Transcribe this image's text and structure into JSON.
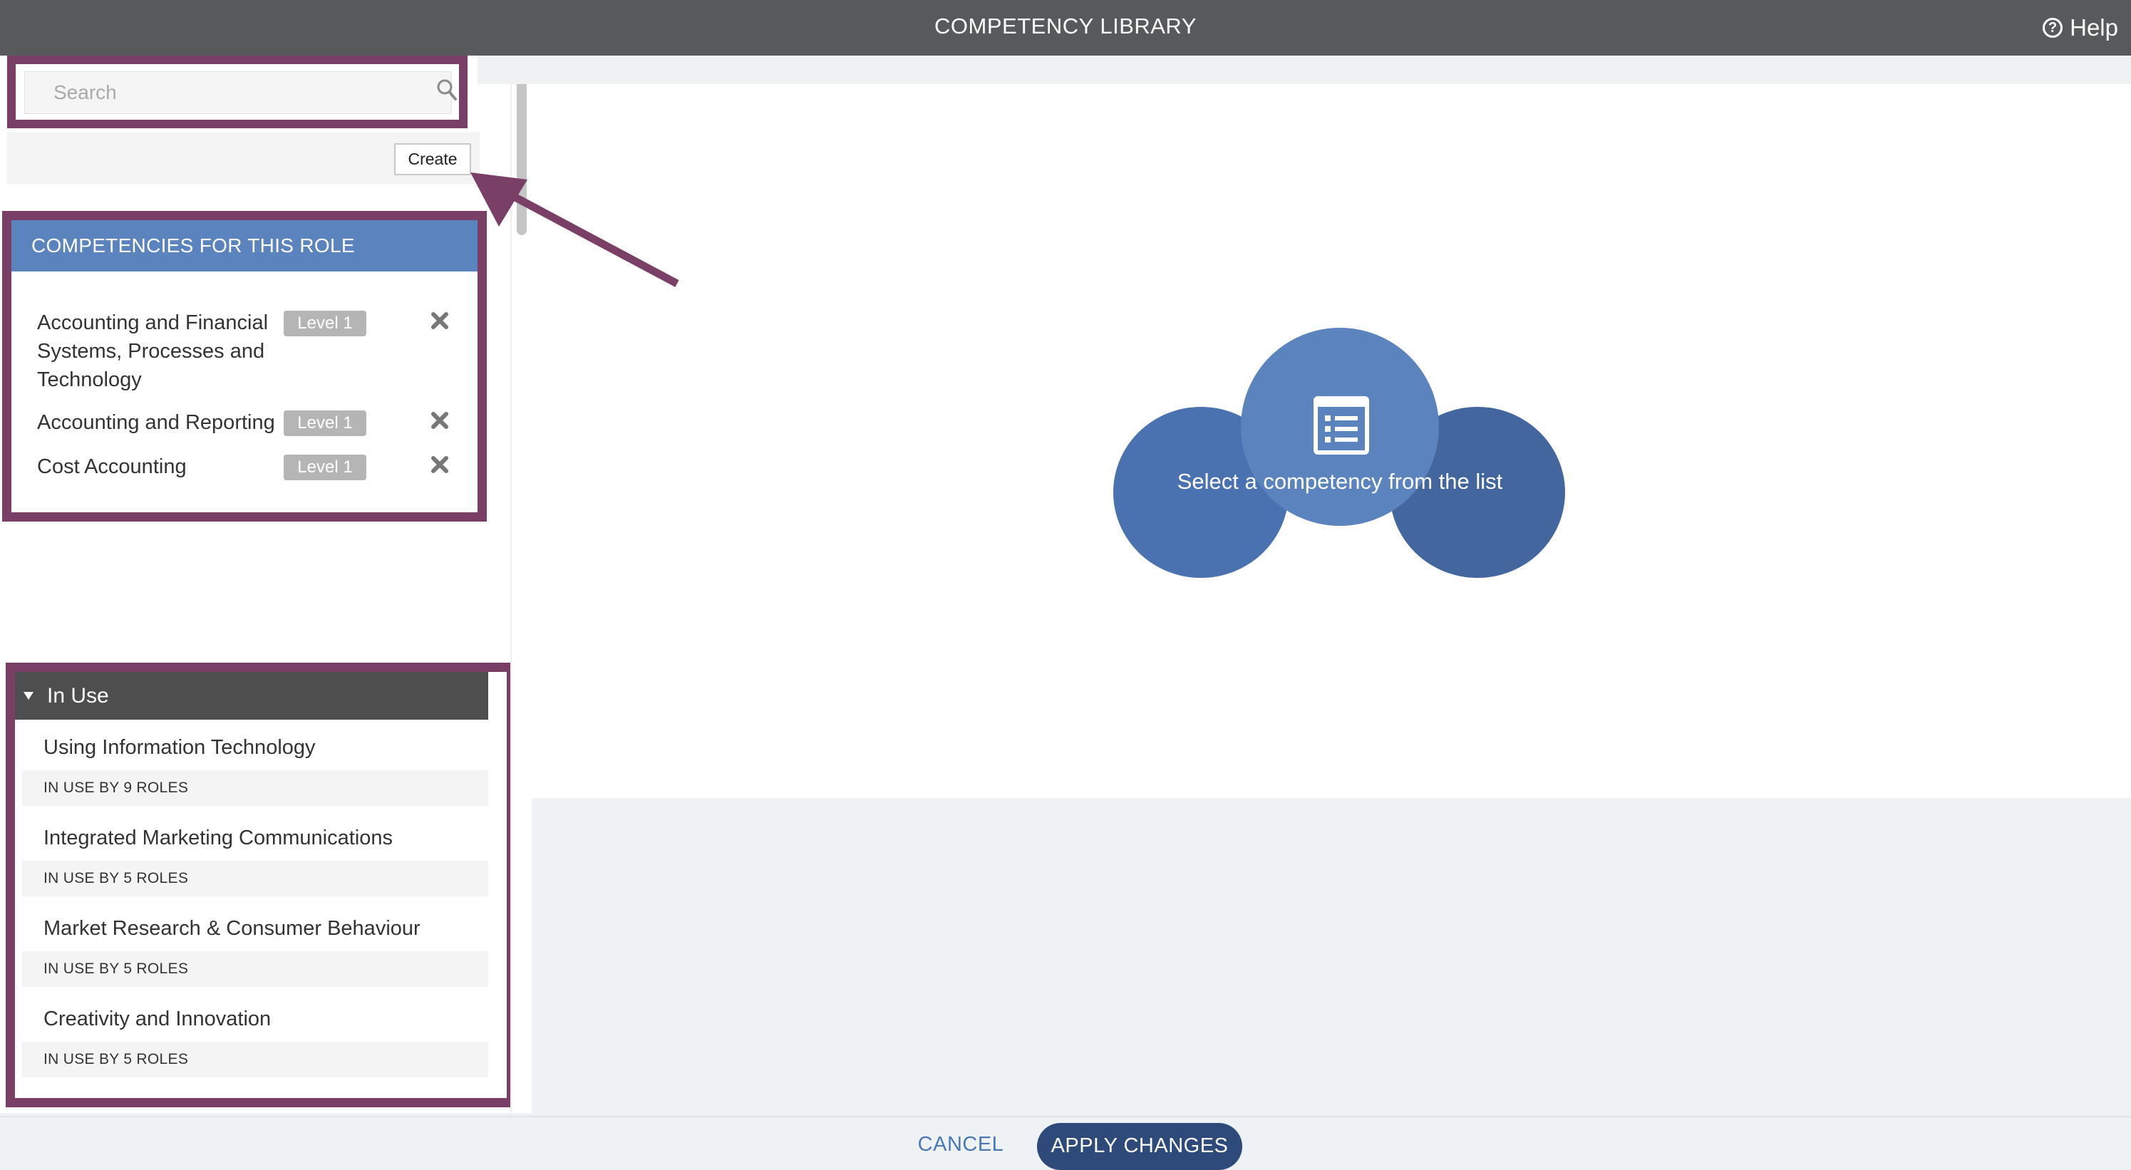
{
  "header": {
    "title": "COMPETENCY LIBRARY",
    "help_label": "Help",
    "help_icon": "question-circle-icon"
  },
  "search": {
    "placeholder": "Search",
    "value": "",
    "icon": "search-icon"
  },
  "create_label": "Create",
  "role_competencies": {
    "heading": "COMPETENCIES FOR THIS ROLE",
    "items": [
      {
        "name": "Accounting and Financial Systems, Processes and Technology",
        "level": "Level 1",
        "remove_icon": "close-icon"
      },
      {
        "name": "Accounting and Reporting",
        "level": "Level 1",
        "remove_icon": "close-icon"
      },
      {
        "name": "Cost Accounting",
        "level": "Level 1",
        "remove_icon": "close-icon"
      }
    ]
  },
  "in_use": {
    "heading": "In Use",
    "items": [
      {
        "title": "Using Information Technology",
        "usage": "IN USE BY 9 ROLES"
      },
      {
        "title": "Integrated Marketing Communications",
        "usage": "IN USE BY 5 ROLES"
      },
      {
        "title": "Market Research & Consumer Behaviour",
        "usage": "IN USE BY 5 ROLES"
      },
      {
        "title": "Creativity and Innovation",
        "usage": "IN USE BY 5 ROLES"
      }
    ]
  },
  "empty_state": {
    "message": "Select a competency from the list",
    "icon": "list-icon"
  },
  "footer": {
    "cancel_label": "CANCEL",
    "apply_label": "APPLY CHANGES"
  },
  "colors": {
    "header_bg": "#58595b",
    "accent_blue": "#5b84be",
    "highlight_frame": "#7a3f67",
    "apply_button": "#2d4a7a",
    "in_use_header": "#4e4e4e"
  }
}
